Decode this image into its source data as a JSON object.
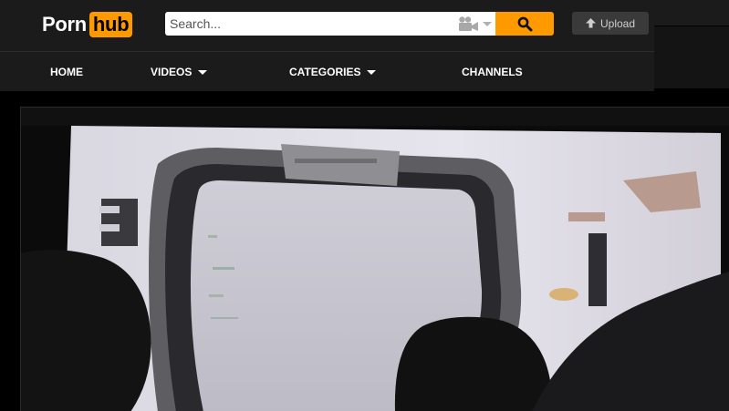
{
  "header": {
    "logo": {
      "part1": "Porn",
      "part2": "hub",
      "accent": "#ff9900"
    },
    "search": {
      "placeholder": "Search...",
      "value": "",
      "filter_icon": "video-camera-icon",
      "button_icon": "search-icon"
    },
    "upload": {
      "label": "Upload",
      "icon": "upload-arrow-icon"
    }
  },
  "nav": {
    "items": [
      {
        "label": "HOME",
        "dropdown": false
      },
      {
        "label": "VIDEOS",
        "dropdown": true
      },
      {
        "label": "CATEGORIES",
        "dropdown": true
      },
      {
        "label": "CHANNELS",
        "dropdown": false
      }
    ]
  },
  "colors": {
    "header_bg": "#1b1b1b",
    "page_bg": "#000000",
    "accent": "#ff9900"
  }
}
